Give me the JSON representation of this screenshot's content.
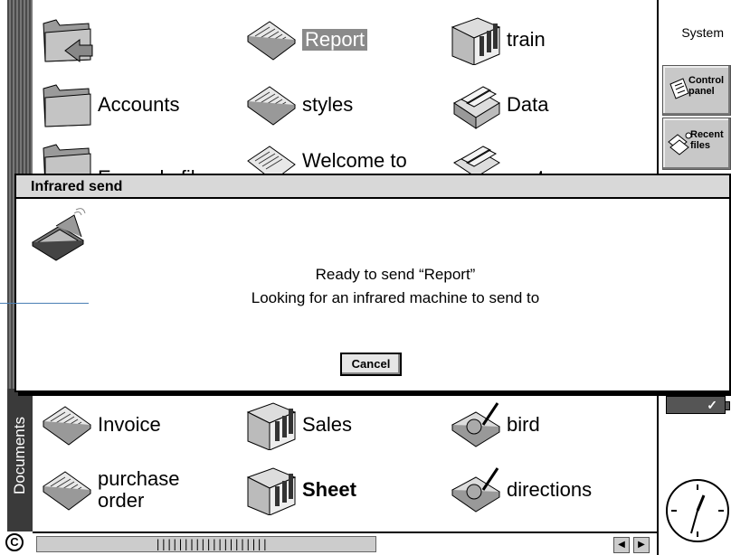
{
  "left_strip": {
    "label": "Documents",
    "c_icon": "C"
  },
  "files": {
    "row1": [
      {
        "label": "",
        "icon": "folder-up-icon"
      },
      {
        "label": "Report",
        "icon": "word-document-icon",
        "selected": true
      },
      {
        "label": "train",
        "icon": "spreadsheet-icon"
      }
    ],
    "row2": [
      {
        "label": "Accounts",
        "icon": "folder-icon"
      },
      {
        "label": "styles",
        "icon": "word-document-icon"
      },
      {
        "label": "Data",
        "icon": "database-icon"
      }
    ],
    "row3": [
      {
        "label": "Example files",
        "icon": "folder-icon"
      },
      {
        "label": "Welcome to",
        "icon": "word-document-icon"
      },
      {
        "label": "parts",
        "icon": "database-icon"
      }
    ],
    "row4": [
      {
        "label": "Invoice",
        "icon": "word-document-icon"
      },
      {
        "label": "Sales",
        "icon": "spreadsheet-icon"
      },
      {
        "label": "bird",
        "icon": "sketch-icon"
      }
    ],
    "row5": [
      {
        "label": "purchase\norder",
        "icon": "word-document-icon"
      },
      {
        "label": "Sheet",
        "icon": "spreadsheet-icon"
      },
      {
        "label": "directions",
        "icon": "sketch-icon"
      }
    ]
  },
  "toolbar": {
    "system": "System",
    "control_panel": "Control panel",
    "recent_files": "Recent files"
  },
  "dialog": {
    "title": "Infrared send",
    "line1": "Ready to send “Report”",
    "line2": "Looking for an infrared machine to send to",
    "cancel": "Cancel"
  },
  "scrollbar": {
    "thumb": "||||||||||||||||||||"
  }
}
